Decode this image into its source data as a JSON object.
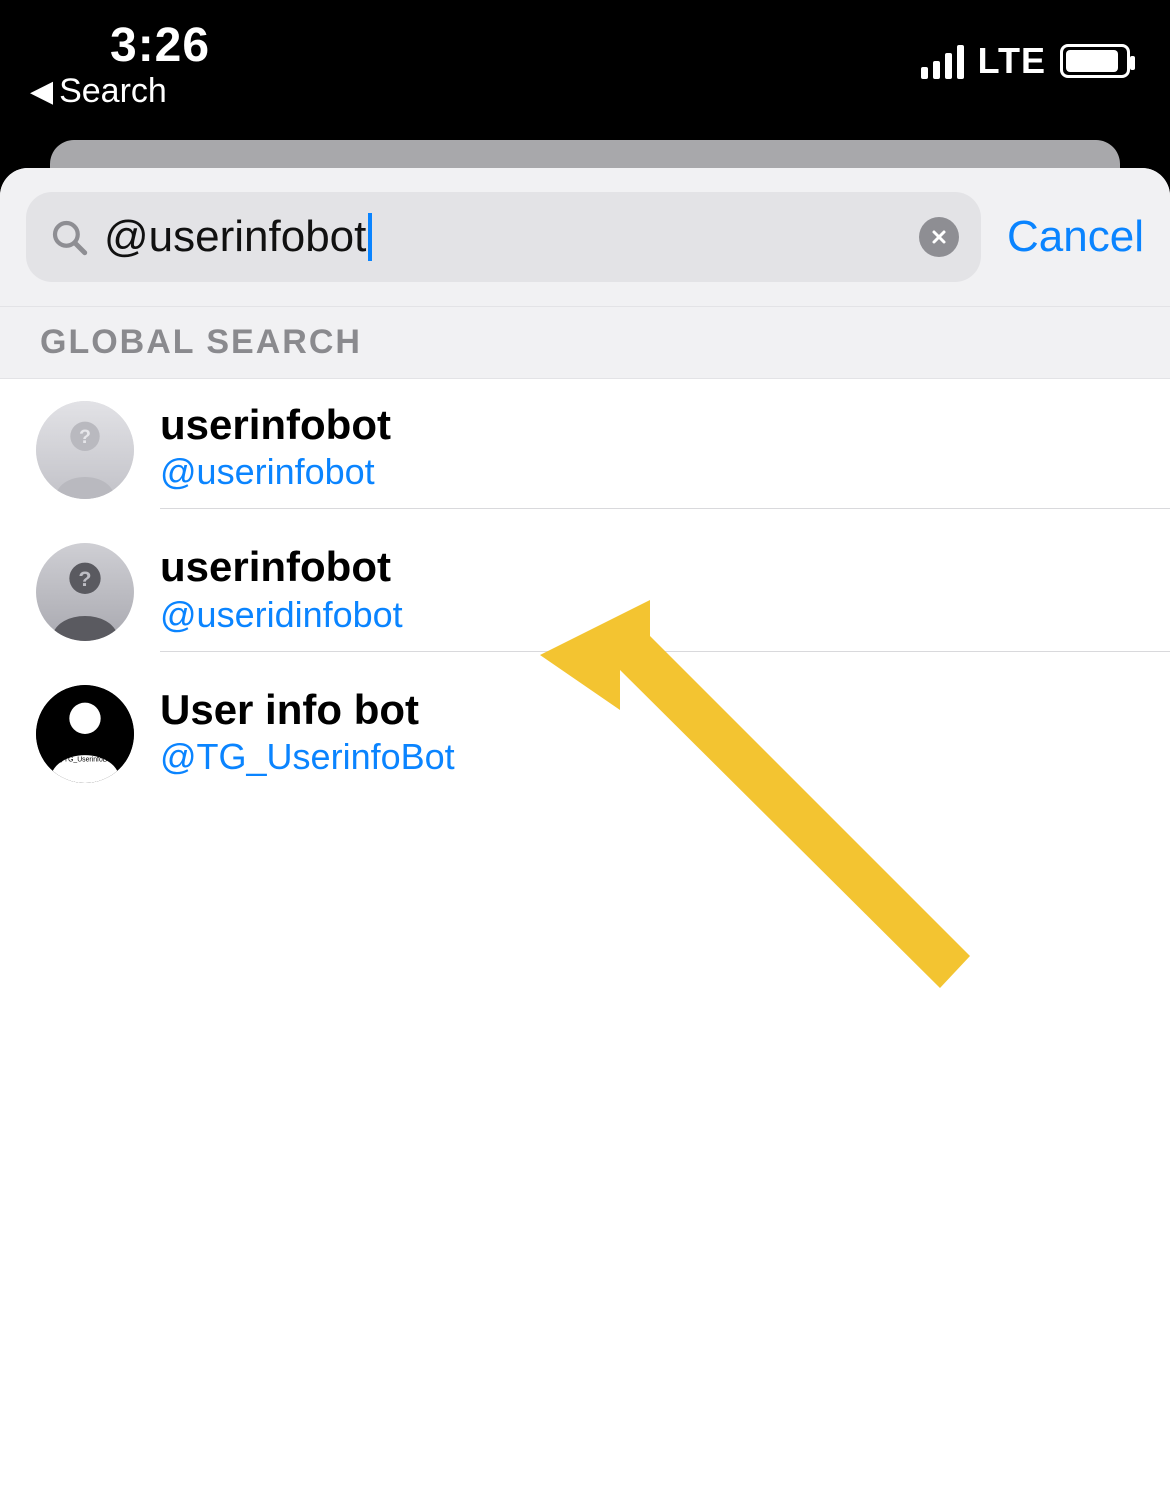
{
  "status": {
    "time": "3:26",
    "network": "LTE",
    "back_label": "Search"
  },
  "search": {
    "query": "@userinfobot",
    "cancel_label": "Cancel"
  },
  "section": {
    "global_search_label": "GLOBAL SEARCH"
  },
  "results": [
    {
      "name": "userinfobot",
      "handle": "@userinfobot",
      "avatar": "placeholder-light"
    },
    {
      "name": "userinfobot",
      "handle": "@useridinfobot",
      "avatar": "placeholder-dark"
    },
    {
      "name": "User info bot",
      "handle": "@TG_UserinfoBot",
      "avatar": "black-person",
      "avatar_caption": "@TG_UserinfoBot"
    }
  ],
  "colors": {
    "accent": "#0a84ff",
    "annotation": "#f3c431"
  }
}
